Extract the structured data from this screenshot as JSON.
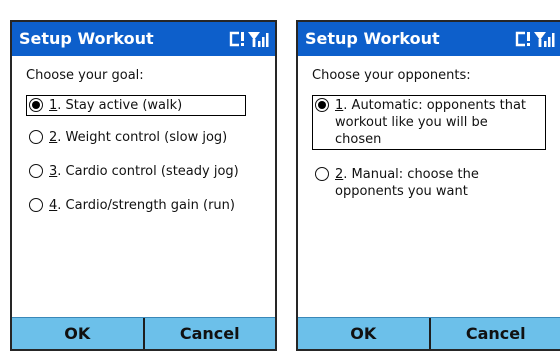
{
  "screens": [
    {
      "title": "Setup Workout",
      "prompt": "Choose your goal:",
      "options": [
        {
          "number": "1",
          "text": ". Stay active (walk)",
          "selected": true
        },
        {
          "number": "2",
          "text": ". Weight control (slow jog)",
          "selected": false
        },
        {
          "number": "3",
          "text": ". Cardio control (steady jog)",
          "selected": false
        },
        {
          "number": "4",
          "text": ". Cardio/strength gain (run)",
          "selected": false
        }
      ],
      "softkeys": {
        "left": "OK",
        "right": "Cancel"
      }
    },
    {
      "title": "Setup Workout",
      "prompt": "Choose your opponents:",
      "options": [
        {
          "number": "1",
          "text": ". Automatic: opponents that workout like you will be chosen",
          "selected": true
        },
        {
          "number": "2",
          "text": ". Manual: choose the opponents you want",
          "selected": false
        }
      ],
      "softkeys": {
        "left": "OK",
        "right": "Cancel"
      }
    }
  ],
  "icons": {
    "connectivity": "connectivity-alert-icon",
    "signal": "signal-strength-icon"
  },
  "colors": {
    "titlebar": "#0d5fcb",
    "softkey_bar": "#6cc0ea"
  }
}
